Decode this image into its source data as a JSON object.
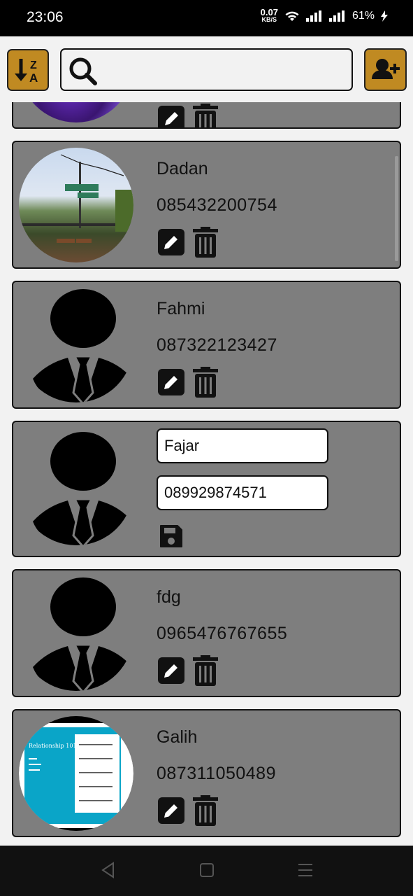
{
  "status_bar": {
    "time": "23:06",
    "net_speed": "0.07",
    "net_unit": "KB/S",
    "battery": "61%"
  },
  "toolbar": {
    "sort_icon": "sort-alpha-desc-icon",
    "search_icon": "search-icon",
    "search_value": "",
    "add_icon": "add-user-icon",
    "accent_color": "#c08a22"
  },
  "contacts": [
    {
      "name": "",
      "phone": "",
      "avatar": "photo-purple",
      "mode": "view"
    },
    {
      "name": "Dadan",
      "phone": "085432200754",
      "avatar": "photo-landscape",
      "mode": "view"
    },
    {
      "name": "Fahmi",
      "phone": "087322123427",
      "avatar": "default-person",
      "mode": "view"
    },
    {
      "name": "Fajar",
      "phone": "089929874571",
      "avatar": "default-person",
      "mode": "edit"
    },
    {
      "name": "fdg",
      "phone": "0965476767655",
      "avatar": "default-person",
      "mode": "view"
    },
    {
      "name": "Galih",
      "phone": "087311050489",
      "avatar": "photo-slide",
      "mode": "view"
    }
  ],
  "colors": {
    "card_bg": "#7e7e7e",
    "page_bg": "#f2f2f2"
  }
}
